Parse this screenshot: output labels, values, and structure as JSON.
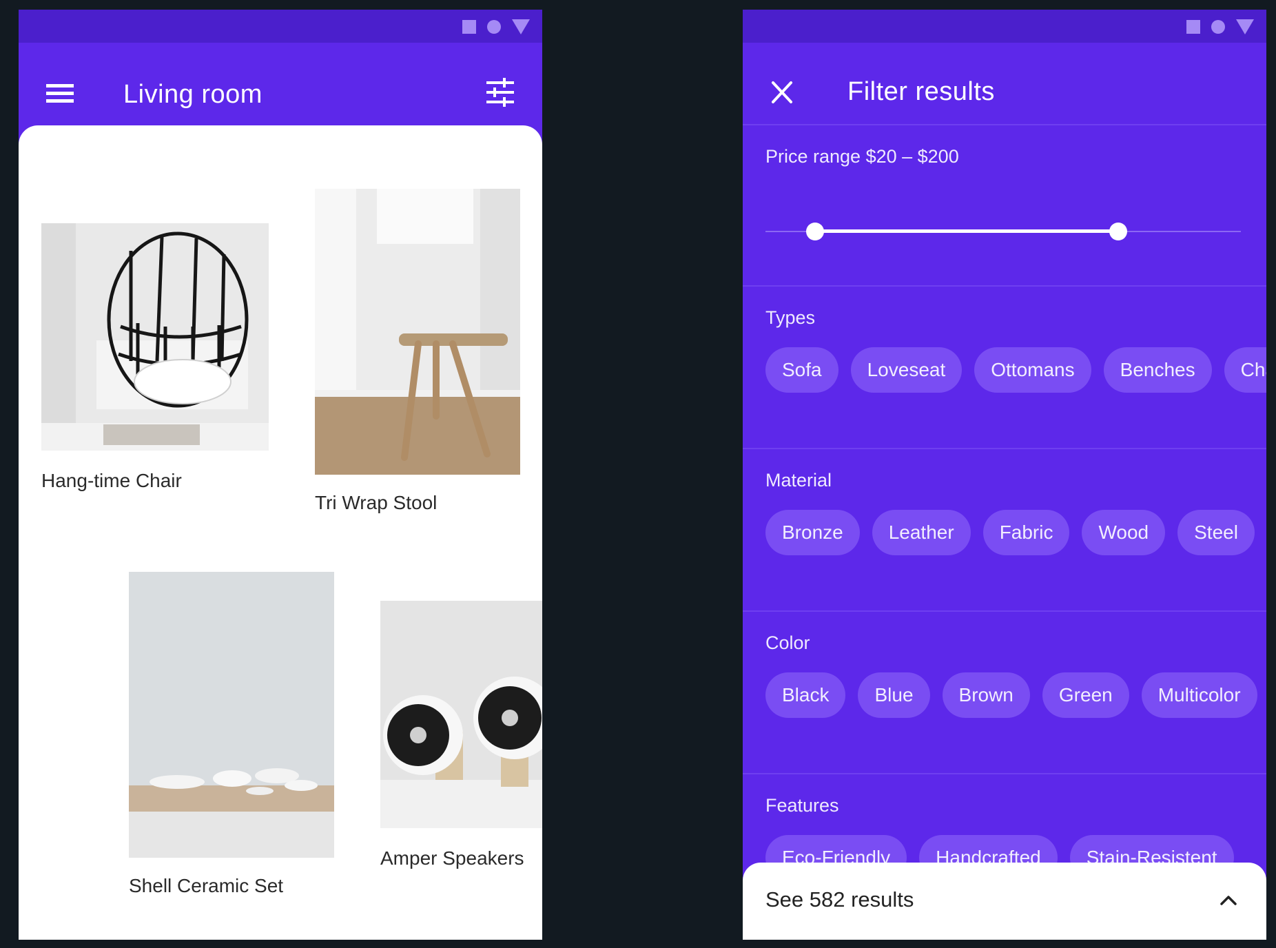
{
  "left_screen": {
    "title": "Living room",
    "products": [
      {
        "name": "Hang-time Chair"
      },
      {
        "name": "Tri Wrap Stool"
      },
      {
        "name": "Shell Ceramic Set"
      },
      {
        "name": "Amper Speakers"
      }
    ]
  },
  "right_screen": {
    "title": "Filter results",
    "price_range": {
      "label": "Price range $20 – $200",
      "min": 20,
      "max": 200
    },
    "sections": [
      {
        "label": "Types",
        "chips": [
          "Sofa",
          "Loveseat",
          "Ottomans",
          "Benches",
          "Chairs"
        ]
      },
      {
        "label": "Material",
        "chips": [
          "Bronze",
          "Leather",
          "Fabric",
          "Wood",
          "Steel"
        ]
      },
      {
        "label": "Color",
        "chips": [
          "Black",
          "Blue",
          "Brown",
          "Green",
          "Multicolor"
        ]
      },
      {
        "label": "Features",
        "chips": [
          "Eco-Friendly",
          "Handcrafted",
          "Stain-Resistent"
        ]
      }
    ],
    "results_button": "See 582 results"
  },
  "colors": {
    "brand_purple": "#5d28ea",
    "status_bar": "#4b1fcc",
    "chip": "#7a4df3",
    "background": "#121a21"
  },
  "icons": [
    "menu-icon",
    "tune-icon",
    "close-icon",
    "chevron-up-icon"
  ]
}
